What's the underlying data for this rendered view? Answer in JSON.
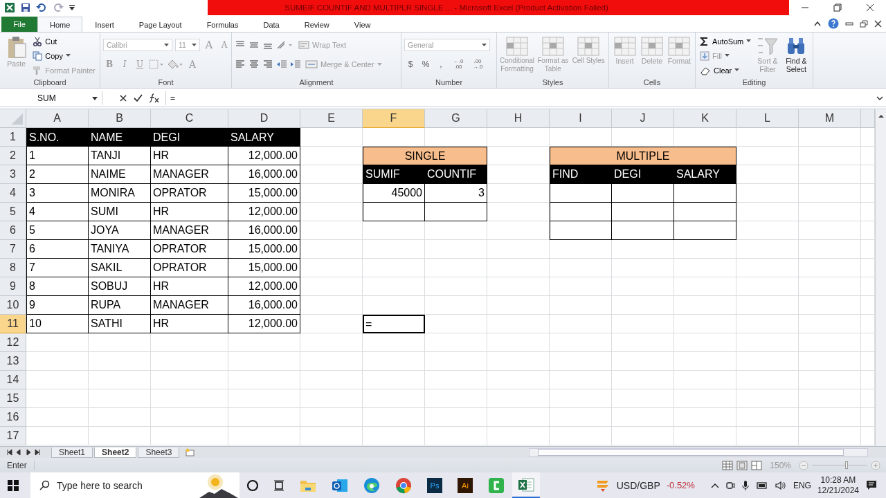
{
  "window": {
    "title": "SUMEIF COUNTIF AND MULTIPLR SINGLE ... - Microsoft Excel (Product Activation Failed)"
  },
  "tabs": [
    {
      "label": "File",
      "kind": "file",
      "selected": false
    },
    {
      "label": "Home",
      "kind": "tab",
      "selected": true
    },
    {
      "label": "Insert",
      "kind": "tab",
      "selected": false
    },
    {
      "label": "Page Layout",
      "kind": "tab",
      "selected": false
    },
    {
      "label": "Formulas",
      "kind": "tab",
      "selected": false
    },
    {
      "label": "Data",
      "kind": "tab",
      "selected": false
    },
    {
      "label": "Review",
      "kind": "tab",
      "selected": false
    },
    {
      "label": "View",
      "kind": "tab",
      "selected": false
    }
  ],
  "ribbon": [
    {
      "kind": "clipboard",
      "label": "Clipboard",
      "large": [
        {
          "label": "Paste",
          "disabled": true
        }
      ],
      "small": [
        {
          "label": "Cut",
          "disabled": false
        },
        {
          "label": "Copy",
          "disabled": false
        },
        {
          "label": "Format Painter",
          "disabled": true
        }
      ]
    },
    {
      "kind": "font",
      "label": "Font",
      "font": "Calibri",
      "size": "11",
      "size_buttons": [
        "A",
        "A"
      ],
      "format_buttons": [
        "B",
        "I",
        "U"
      ],
      "color_button": "A"
    },
    {
      "kind": "alignment",
      "label": "Alignment",
      "small": [
        {
          "label": "Wrap Text",
          "disabled": true
        },
        {
          "label": "Merge & Center",
          "disabled": true
        }
      ]
    },
    {
      "kind": "number",
      "label": "Number",
      "format": "General",
      "symbols": [
        "$",
        "%",
        ","
      ],
      "decimals": [
        {
          "top": "←.0",
          "bottom": ".00"
        },
        {
          "top": ".00",
          "bottom": "→.0"
        }
      ]
    },
    {
      "kind": "styles",
      "label": "Styles",
      "large": [
        {
          "label": "Conditional Formatting",
          "disabled": true
        },
        {
          "label": "Format as Table",
          "disabled": true
        },
        {
          "label": "Cell Styles",
          "disabled": true
        }
      ]
    },
    {
      "kind": "cells",
      "label": "Cells",
      "large": [
        {
          "label": "Insert",
          "disabled": true
        },
        {
          "label": "Delete",
          "disabled": true
        },
        {
          "label": "Format",
          "disabled": true
        }
      ]
    },
    {
      "kind": "editing",
      "label": "Editing",
      "small": [
        {
          "label": "AutoSum",
          "disabled": false
        },
        {
          "label": "Fill",
          "disabled": true
        },
        {
          "label": "Clear",
          "disabled": false
        }
      ],
      "large": [
        {
          "label": "Sort & Filter",
          "disabled": true
        },
        {
          "label": "Find & Select",
          "disabled": false
        }
      ]
    }
  ],
  "formula_bar": {
    "name_box": "SUM",
    "formula": "="
  },
  "sheet": {
    "columns": [
      {
        "label": "A",
        "selected": false
      },
      {
        "label": "B",
        "selected": false
      },
      {
        "label": "C",
        "selected": false
      },
      {
        "label": "D",
        "selected": false
      },
      {
        "label": "E",
        "selected": false
      },
      {
        "label": "F",
        "selected": true
      },
      {
        "label": "G",
        "selected": false
      },
      {
        "label": "H",
        "selected": false
      },
      {
        "label": "I",
        "selected": false
      },
      {
        "label": "J",
        "selected": false
      },
      {
        "label": "K",
        "selected": false
      },
      {
        "label": "L",
        "selected": false
      },
      {
        "label": "M",
        "selected": false
      }
    ],
    "rows": [
      {
        "label": "1",
        "selected": false
      },
      {
        "label": "2",
        "selected": false
      },
      {
        "label": "3",
        "selected": false
      },
      {
        "label": "4",
        "selected": false
      },
      {
        "label": "5",
        "selected": false
      },
      {
        "label": "6",
        "selected": false
      },
      {
        "label": "7",
        "selected": false
      },
      {
        "label": "8",
        "selected": false
      },
      {
        "label": "9",
        "selected": false
      },
      {
        "label": "10",
        "selected": false
      },
      {
        "label": "11",
        "selected": true
      },
      {
        "label": "12",
        "selected": false
      },
      {
        "label": "13",
        "selected": false
      },
      {
        "label": "14",
        "selected": false
      },
      {
        "label": "15",
        "selected": false
      },
      {
        "label": "16",
        "selected": false
      },
      {
        "label": "17",
        "selected": false
      }
    ],
    "tables": [
      {
        "columns": [
          "S.NO.",
          "NAME",
          "DEGI",
          "SALARY"
        ],
        "rows": [
          {
            "cells": [
              "1",
              "TANJI",
              "HR",
              "12,000.00"
            ]
          },
          {
            "cells": [
              "2",
              "NAIME",
              "MANAGER",
              "16,000.00"
            ]
          },
          {
            "cells": [
              "3",
              "MONIRA",
              "OPRATOR",
              "15,000.00"
            ]
          },
          {
            "cells": [
              "4",
              "SUMI",
              "HR",
              "12,000.00"
            ]
          },
          {
            "cells": [
              "5",
              "JOYA",
              "MANAGER",
              "16,000.00"
            ]
          },
          {
            "cells": [
              "6",
              "TANIYA",
              "OPRATOR",
              "15,000.00"
            ]
          },
          {
            "cells": [
              "7",
              "SAKIL",
              "OPRATOR",
              "15,000.00"
            ]
          },
          {
            "cells": [
              "8",
              "SOBUJ",
              "HR",
              "12,000.00"
            ]
          },
          {
            "cells": [
              "9",
              "RUPA",
              "MANAGER",
              "16,000.00"
            ]
          },
          {
            "cells": [
              "10",
              "SATHI",
              "HR",
              "12,000.00"
            ]
          }
        ]
      },
      {
        "title": "SINGLE",
        "columns": [
          "SUMIF",
          "COUNTIF"
        ],
        "rows": [
          {
            "cells": [
              "45000",
              "3"
            ]
          },
          {
            "blank": true
          }
        ]
      },
      {
        "title": "MULTIPLE",
        "columns": [
          "FIND",
          "DEGI",
          "SALARY"
        ],
        "rows": [
          {
            "blank": true
          },
          {
            "blank": true
          },
          {
            "blank": true
          }
        ]
      }
    ],
    "active_cell": {
      "text": "="
    }
  },
  "sheet_tabs": [
    {
      "label": "Sheet1",
      "selected": false
    },
    {
      "label": "Sheet2",
      "selected": true
    },
    {
      "label": "Sheet3",
      "selected": false
    }
  ],
  "status_bar": {
    "mode": "Enter",
    "zoom": "150%",
    "zoom_slider": {
      "level": 0.62
    }
  },
  "taskbar": {
    "search": {
      "placeholder": "Type here to search"
    },
    "app_badges": [
      "Ps",
      "Ai"
    ],
    "ticker": {
      "symbol": "USD/GBP",
      "change": "-0.52%"
    },
    "language": "ENG",
    "time": "10:28 AM",
    "date": "12/21/2024"
  }
}
